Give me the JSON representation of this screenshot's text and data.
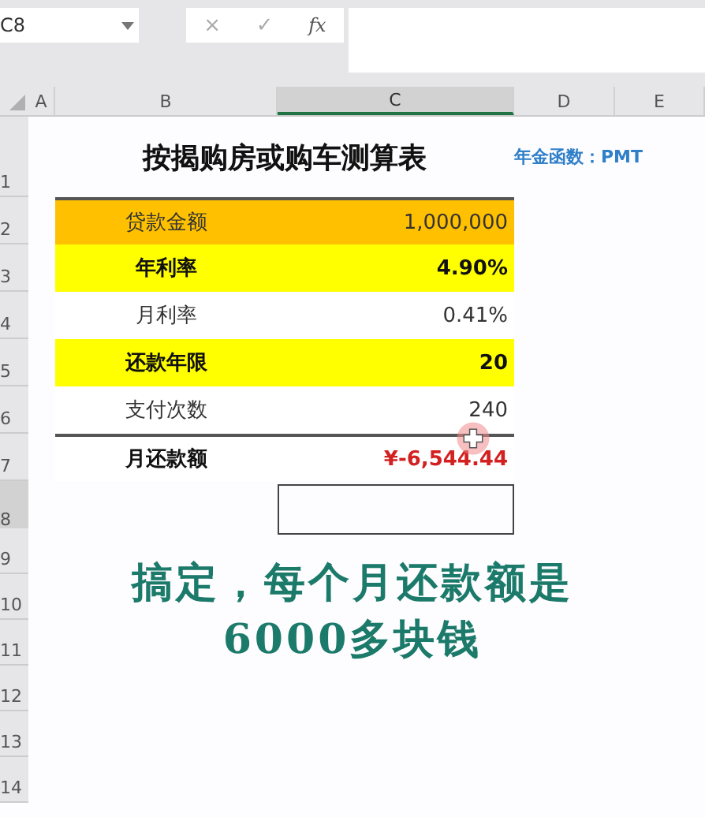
{
  "formula_bar": {
    "name_box": "C8",
    "cancel_icon": "×",
    "enter_icon": "✓",
    "function_icon": "fx"
  },
  "columns": [
    {
      "label": "A",
      "selected": false
    },
    {
      "label": "B",
      "selected": false
    },
    {
      "label": "C",
      "selected": true
    },
    {
      "label": "D",
      "selected": false
    },
    {
      "label": "E",
      "selected": false
    }
  ],
  "rows": [
    {
      "number": "1",
      "selected": false,
      "kind": "title",
      "title": "按揭购房或购车测算表",
      "note": "年金函数：PMT"
    },
    {
      "number": "2",
      "selected": false,
      "kind": "data",
      "label": "贷款金额",
      "value": "1,000,000",
      "color": "#ffc000",
      "bold": false,
      "rule_above": true
    },
    {
      "number": "3",
      "selected": false,
      "kind": "data",
      "label": "年利率",
      "value": "4.90%",
      "color": "#ffff00",
      "bold": true,
      "rule_above": false
    },
    {
      "number": "4",
      "selected": false,
      "kind": "data",
      "label": "月利率",
      "value": "0.41%",
      "color": "#ffffff",
      "bold": false,
      "rule_above": false
    },
    {
      "number": "5",
      "selected": false,
      "kind": "data",
      "label": "还款年限",
      "value": "20",
      "color": "#ffff00",
      "bold": true,
      "rule_above": false
    },
    {
      "number": "6",
      "selected": false,
      "kind": "data",
      "label": "支付次数",
      "value": "240",
      "color": "#ffffff",
      "bold": false,
      "rule_above": false
    },
    {
      "number": "7",
      "selected": false,
      "kind": "result",
      "label": "月还款额",
      "value": "¥-6,544.44",
      "color": "#ffffff",
      "bold": true,
      "rule_above": true
    },
    {
      "number": "8",
      "selected": true,
      "kind": "active",
      "cell_selected": true
    },
    {
      "number": "9",
      "selected": false,
      "kind": "empty"
    },
    {
      "number": "10",
      "selected": false,
      "kind": "empty"
    },
    {
      "number": "11",
      "selected": false,
      "kind": "empty"
    },
    {
      "number": "12",
      "selected": false,
      "kind": "empty"
    },
    {
      "number": "13",
      "selected": false,
      "kind": "empty"
    },
    {
      "number": "14",
      "selected": false,
      "kind": "empty"
    }
  ],
  "subtitle": [
    "搞定，每个月还款额是",
    "6000多块钱"
  ]
}
